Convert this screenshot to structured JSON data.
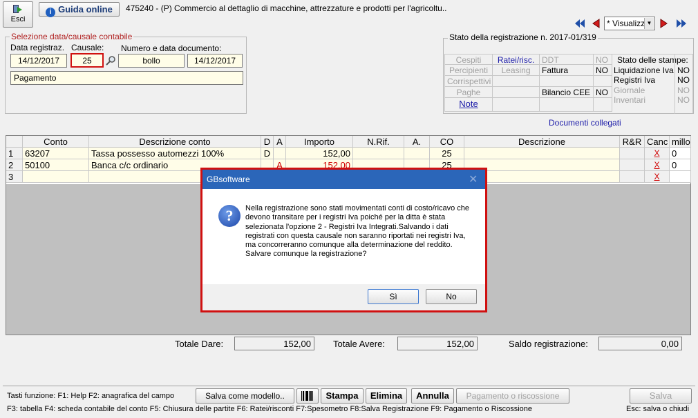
{
  "toolbar": {
    "esci_label": "Esci",
    "guida_label": "Guida online",
    "company_title": "475240 - (P) Commercio al dettaglio di macchine, attrezzature e prodotti per l'agricoltu..",
    "view_select": "* Visualizz"
  },
  "selection": {
    "legend": "Selezione data/causale contabile",
    "data_label": "Data registraz.",
    "causale_label": "Causale:",
    "numero_label": "Numero e data documento:",
    "data_value": "14/12/2017",
    "causale_value": "25",
    "numero_value": "bollo",
    "data_doc_value": "14/12/2017",
    "causale_desc": "Pagamento"
  },
  "stato": {
    "title": "Stato della registrazione n. 2017-01/319",
    "cespiti": "Cespiti",
    "ratei": "Ratei/risc.",
    "ddt": "DDT",
    "ddt_val": "NO",
    "percipienti": "Percipienti",
    "leasing": "Leasing",
    "fattura": "Fattura",
    "fattura_val": "NO",
    "corrispettivi": "Corrispettivi",
    "paghe": "Paghe",
    "bilancio": "Bilancio CEE",
    "bilancio_val": "NO",
    "note": "Note",
    "stampe_title": "Stato delle stampe:",
    "liquidazione": "Liquidazione Iva",
    "liquidazione_val": "NO",
    "registri": "Registri Iva",
    "registri_val": "NO",
    "giornale": "Giornale",
    "giornale_val": "NO",
    "inventari": "Inventari",
    "inventari_val": "NO",
    "documenti": "Documenti collegati"
  },
  "grid": {
    "headers": [
      "",
      "Conto",
      "Descrizione conto",
      "D",
      "A",
      "Importo",
      "N.Rif.",
      "A.",
      "CO",
      "Descrizione",
      "R&R",
      "Canc",
      "millo"
    ],
    "rows": [
      {
        "n": "1",
        "conto": "63207",
        "desc": "Tassa possesso automezzi 100%",
        "d": "D",
        "a": "",
        "importo": "152,00",
        "co": "25",
        "canc": "X",
        "millo": "0"
      },
      {
        "n": "2",
        "conto": "50100",
        "desc": "Banca c/c ordinario",
        "d": "",
        "a": "A",
        "importo": "152,00",
        "co": "25",
        "canc": "X",
        "millo": "0"
      },
      {
        "n": "3",
        "conto": "",
        "desc": "",
        "d": "",
        "a": "",
        "importo": "",
        "co": "",
        "canc": "X",
        "millo": ""
      }
    ]
  },
  "totals": {
    "dare_label": "Totale Dare:",
    "dare_value": "152,00",
    "avere_label": "Totale Avere:",
    "avere_value": "152,00",
    "saldo_label": "Saldo registrazione:",
    "saldo_value": "0,00"
  },
  "dialog": {
    "title": "GBsoftware",
    "message": "Nella registrazione sono stati movimentati conti di costo/ricavo che devono transitare per i registri Iva poiché per la ditta è stata selezionata l'opzione 2 - Registri Iva Integrati.Salvando i dati registrati con questa causale non saranno riportati nei registri Iva, ma concorreranno comunque alla determinazione del reddito.\nSalvare comunque la registrazione?",
    "yes": "Sì",
    "no": "No"
  },
  "footer": {
    "keys1": "Tasti funzione: F1: Help  F2: anagrafica del campo",
    "salva_modello": "Salva come modello..",
    "stampa": "Stampa",
    "elimina": "Elimina",
    "annulla": "Annulla",
    "pagamento": "Pagamento o riscossione",
    "salva": "Salva",
    "keys2": "F3: tabella   F4: scheda contabile del conto  F5: Chiusura delle partite         F6: Ratei/risconti   F7:Spesometro   F8:Salva Registrazione       F9: Pagamento o Riscossione",
    "esc": "Esc: salva o chiudi"
  }
}
